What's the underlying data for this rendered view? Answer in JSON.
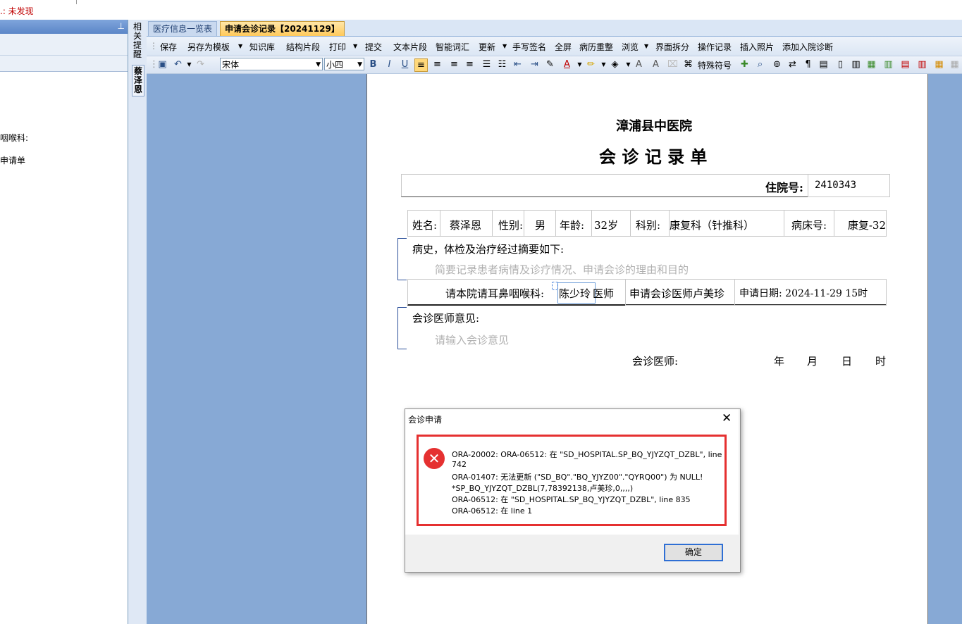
{
  "warning_text": ".: 未发现",
  "left_panel": {
    "pin_icon": "pin-icon",
    "items": [
      "咽喉科:",
      "申请单"
    ]
  },
  "vertical_tabs": [
    "相关提醒",
    "蔡泽恩"
  ],
  "tabs": [
    {
      "label": "医疗信息一览表",
      "active": false
    },
    {
      "label": "申请会诊记录【20241129】",
      "active": true
    }
  ],
  "toolbar": {
    "items": [
      "保存",
      "另存为模板",
      "知识库",
      "结构片段",
      "打印",
      "提交",
      "文本片段",
      "智能词汇",
      "更新",
      "手写签名",
      "全屏",
      "病历重整",
      "浏览",
      "界面拆分",
      "操作记录",
      "插入照片",
      "添加入院诊断"
    ]
  },
  "format_bar": {
    "font_name": "宋体",
    "font_size": "小四",
    "special_symbol": "特殊符号"
  },
  "document": {
    "hospital": "漳浦县中医院",
    "title": "会 诊 记 录 单",
    "admission_label": "住院号:",
    "admission_no": "2410343",
    "name_label": "姓名:",
    "name": "蔡泽恩",
    "gender_label": "性别:",
    "gender": "男",
    "age_label": "年龄:",
    "age": "32岁",
    "dept_label": "科别:",
    "dept": "康复科（针推科）",
    "bed_label": "病床号:",
    "bed": "康复-32",
    "history_label": "病史，体检及治疗经过摘要如下:",
    "history_placeholder": "简要记录患者病情及诊疗情况、申请会诊的理由和目的",
    "request_text": "请本院请耳鼻咽喉科:",
    "request_doctor": "陈少玲",
    "doctor_suffix": "医师",
    "applicant": "申请会诊医师卢美珍",
    "apply_date": "申请日期: 2024-11-29 15时",
    "opinion_label": "会诊医师意见:",
    "opinion_placeholder": "请输入会诊意见",
    "consult_doctor_label": "会诊医师:",
    "date_year": "年",
    "date_month": "月",
    "date_day": "日",
    "date_hour": "时"
  },
  "dialog": {
    "title": "会诊申请",
    "close_icon": "close-icon",
    "error_icon": "error-icon",
    "messages": [
      "ORA-20002: ORA-06512: 在 \"SD_HOSPITAL.SP_BQ_YJYZQT_DZBL\", line",
      "742",
      "ORA-01407: 无法更新 (\"SD_BQ\".\"BQ_YJYZ00\".\"QYRQ00\") 为 NULL!",
      "*SP_BQ_YJYZQT_DZBL(7,78392138,卢美珍,0,,,,)",
      "ORA-06512: 在 \"SD_HOSPITAL.SP_BQ_YJYZQT_DZBL\", line 835",
      "ORA-06512: 在 line 1"
    ],
    "ok_label": "确定",
    "error_color": "#e53030"
  }
}
